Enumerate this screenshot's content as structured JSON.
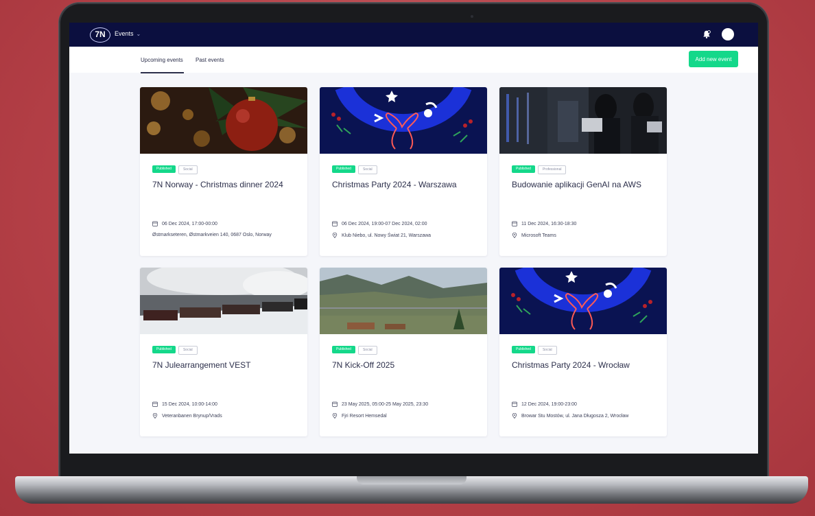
{
  "colors": {
    "nav_bg": "#0b0f3f",
    "accent": "#14d88a",
    "text": "#2b2e4a",
    "page_bg": "#f5f6fa",
    "wall": "#b64148"
  },
  "nav": {
    "logo_text": "7N",
    "menu_label": "Events",
    "icons": [
      "chevron-down-icon",
      "notification-bell-icon",
      "avatar"
    ]
  },
  "tabs": [
    {
      "label": "Upcoming events",
      "active": true
    },
    {
      "label": "Past events",
      "active": false
    }
  ],
  "actions": {
    "add_event": "Add new event"
  },
  "events": [
    {
      "image": "christmas-ornament-photo",
      "status": "Published",
      "category": "Social",
      "title": "7N Norway - Christmas dinner 2024",
      "date": "06 Dec 2024, 17:00-00:00",
      "location": "Østmarkseteren, Østmarkveien 140, 0687 Oslo, Norway"
    },
    {
      "image": "christmas-wreath-illustration",
      "status": "Published",
      "category": "Social",
      "title": "Christmas Party 2024 - Warszawa",
      "date": "06 Dec 2024, 19:00-07 Dec 2024, 02:00",
      "location": "Klub Niebo, ul. Nowy Świat 21, Warszawa"
    },
    {
      "image": "server-room-photo",
      "status": "Published",
      "category": "Professional",
      "title": "Budowanie aplikacji GenAI na AWS",
      "date": "11 Dec 2024, 16:30-18:30",
      "location": "Microsoft Teams"
    },
    {
      "image": "steam-train-photo",
      "status": "Published",
      "category": "Social",
      "title": "7N Julearrangement VEST",
      "date": "15 Dec 2024, 10:00-14:00",
      "location": "Veteranbanen Brynup/Vrads"
    },
    {
      "image": "mountain-resort-photo",
      "status": "Published",
      "category": "Social",
      "title": "7N Kick-Off 2025",
      "date": "23 May 2025, 05:00-25 May 2025, 23:30",
      "location": "Fjri Resort Hemsedal"
    },
    {
      "image": "christmas-wreath-illustration",
      "status": "Published",
      "category": "Social",
      "title": "Christmas Party 2024 - Wrocław",
      "date": "12 Dec 2024, 19:00-23:00",
      "location": "Browar Stu Mostów, ul. Jana Długosza 2, Wrocław"
    }
  ]
}
